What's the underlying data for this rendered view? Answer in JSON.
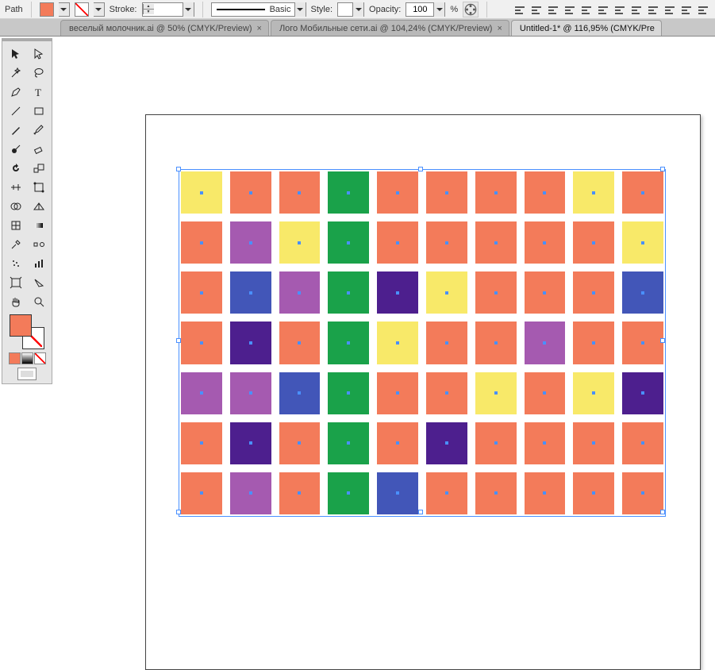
{
  "controlbar": {
    "mode_label": "Path",
    "fill_color": "#f37b5a",
    "stroke_label": "Stroke:",
    "stroke_value": "",
    "brush_label": "Basic",
    "style_label": "Style:",
    "opacity_label": "Opacity:",
    "opacity_value": "100",
    "opacity_unit": "%"
  },
  "tabs": [
    {
      "label": "веселый молочник.ai @ 50% (CMYK/Preview)",
      "active": false
    },
    {
      "label": "Лого Мобильные сети.ai @ 104,24% (CMYK/Preview)",
      "active": false
    },
    {
      "label": "Untitled-1* @ 116,95% (CMYK/Pre",
      "active": true
    }
  ],
  "colors": {
    "orange": "#f37b5a",
    "yellow": "#f8e969",
    "purple": "#a55ab0",
    "green": "#1aa24a",
    "blue": "#4256b8",
    "dpurple": "#4d1f8e"
  },
  "fill_color": "#f37b5a",
  "grid": {
    "rows": 7,
    "cols": 10,
    "cells": [
      [
        "yellow",
        "orange",
        "orange",
        "green",
        "orange",
        "orange",
        "orange",
        "orange",
        "yellow",
        "orange"
      ],
      [
        "orange",
        "purple",
        "yellow",
        "green",
        "orange",
        "orange",
        "orange",
        "orange",
        "orange",
        "yellow"
      ],
      [
        "orange",
        "blue",
        "purple",
        "green",
        "dpurple",
        "yellow",
        "orange",
        "orange",
        "orange",
        "blue"
      ],
      [
        "orange",
        "dpurple",
        "orange",
        "green",
        "yellow",
        "orange",
        "orange",
        "purple",
        "orange",
        "orange"
      ],
      [
        "purple",
        "purple",
        "blue",
        "green",
        "orange",
        "orange",
        "yellow",
        "orange",
        "yellow",
        "dpurple"
      ],
      [
        "orange",
        "dpurple",
        "orange",
        "green",
        "orange",
        "dpurple",
        "orange",
        "orange",
        "orange",
        "orange"
      ],
      [
        "orange",
        "purple",
        "orange",
        "green",
        "blue",
        "orange",
        "orange",
        "orange",
        "orange",
        "orange"
      ]
    ]
  },
  "align_icons": [
    "align-horizontal-left",
    "align-horizontal-center",
    "align-horizontal-right",
    "align-vertical-top",
    "align-vertical-center",
    "align-vertical-bottom",
    "distribute-horizontal",
    "distribute-horizontal-center",
    "distribute-vertical",
    "distribute-vertical-center",
    "distribute-spacing-h",
    "distribute-spacing-v"
  ],
  "tools": [
    [
      "selection-tool",
      "direct-selection-tool"
    ],
    [
      "magic-wand-tool",
      "lasso-tool"
    ],
    [
      "pen-tool",
      "type-tool"
    ],
    [
      "line-tool",
      "rectangle-tool"
    ],
    [
      "paintbrush-tool",
      "pencil-tool"
    ],
    [
      "blob-brush-tool",
      "eraser-tool"
    ],
    [
      "rotate-tool",
      "scale-tool"
    ],
    [
      "width-tool",
      "free-transform-tool"
    ],
    [
      "shape-builder-tool",
      "perspective-tool"
    ],
    [
      "mesh-tool",
      "gradient-tool"
    ],
    [
      "eyedropper-tool",
      "blend-tool"
    ],
    [
      "symbol-sprayer-tool",
      "graph-tool"
    ],
    [
      "artboard-tool",
      "slice-tool"
    ],
    [
      "hand-tool",
      "zoom-tool"
    ]
  ]
}
